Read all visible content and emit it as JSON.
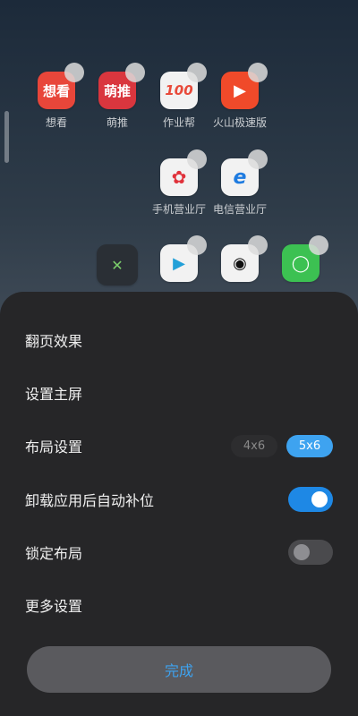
{
  "apps": [
    {
      "label": "想看",
      "glyph": "想看",
      "bg": "#e8463a",
      "fg": "#ffffff"
    },
    {
      "label": "萌推",
      "glyph": "萌推",
      "bg": "#d9363e",
      "fg": "#ffffff"
    },
    {
      "label": "作业帮",
      "glyph": "100",
      "bg": "#f2f2f2",
      "fg": "#e84a3a"
    },
    {
      "label": "火山极速版",
      "glyph": "▶",
      "bg": "#f04a2a",
      "fg": "#ffffff"
    },
    {
      "label": "手机营业厅",
      "glyph": "✿",
      "bg": "#f2f2f2",
      "fg": "#e0313a"
    },
    {
      "label": "电信营业厅",
      "glyph": "e",
      "bg": "#f2f2f2",
      "fg": "#1e7be0"
    },
    {
      "label": "",
      "glyph": "✕",
      "bg": "#2a2f35",
      "fg": "#7ccf6b"
    },
    {
      "label": "",
      "glyph": "▶",
      "bg": "#f2f2f2",
      "fg": "#22a0d8"
    },
    {
      "label": "",
      "glyph": "◉",
      "bg": "#f2f2f2",
      "fg": "#111111"
    },
    {
      "label": "",
      "glyph": "◯",
      "bg": "#3cc152",
      "fg": "#ffffff"
    }
  ],
  "sheet": {
    "page_effect": "翻页效果",
    "set_home": "设置主屏",
    "layout": {
      "label": "布局设置",
      "opt_a": "4x6",
      "opt_b": "5x6",
      "selected": "5x6"
    },
    "auto_fill": {
      "label": "卸载应用后自动补位",
      "on": true
    },
    "lock_layout": {
      "label": "锁定布局",
      "on": false
    },
    "more": "更多设置",
    "done": "完成"
  },
  "colors": {
    "accent": "#3ea3f0",
    "toggle_on": "#1e88e5"
  }
}
